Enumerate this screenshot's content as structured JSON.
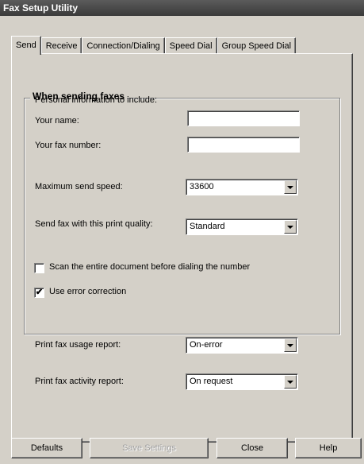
{
  "window": {
    "title": "Fax Setup Utility"
  },
  "tabs": [
    {
      "label": "Send"
    },
    {
      "label": "Receive"
    },
    {
      "label": "Connection/Dialing"
    },
    {
      "label": "Speed Dial"
    },
    {
      "label": "Group Speed Dial"
    }
  ],
  "send": {
    "group_title": "When sending faxes",
    "personal_info": "Personal information to include:",
    "your_name_label": "Your name:",
    "your_name_value": "",
    "fax_number_label": "Your fax number:",
    "fax_number_value": "",
    "max_speed_label": "Maximum send speed:",
    "max_speed_value": "33600",
    "print_quality_label": "Send fax with this print quality:",
    "print_quality_value": "Standard",
    "scan_entire_label": "Scan the entire document before dialing the number",
    "scan_entire_checked": false,
    "error_correction_label": "Use error correction",
    "error_correction_checked": true,
    "usage_report_label": "Print fax usage report:",
    "usage_report_value": "On-error",
    "activity_report_label": "Print fax activity report:",
    "activity_report_value": "On request"
  },
  "buttons": {
    "defaults": "Defaults",
    "save": "Save Settings",
    "close": "Close",
    "help": "Help"
  }
}
